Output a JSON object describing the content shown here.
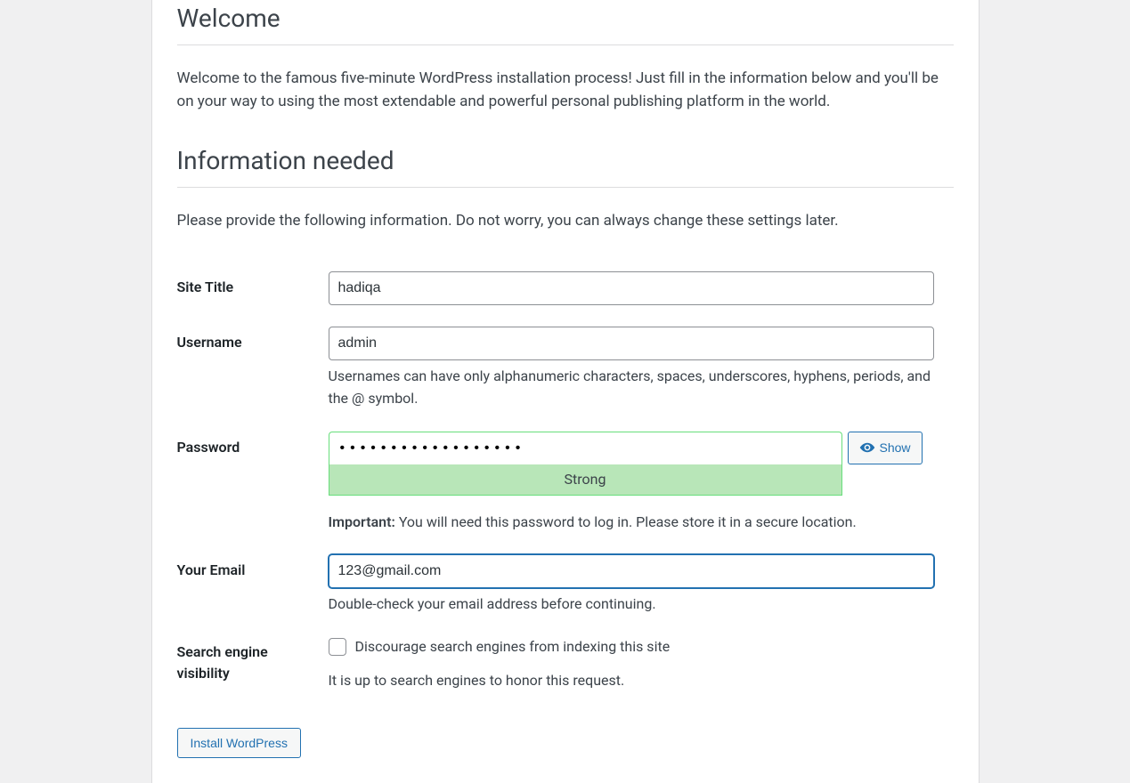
{
  "headings": {
    "welcome": "Welcome",
    "info_needed": "Information needed"
  },
  "intro": {
    "welcome_text": "Welcome to the famous five-minute WordPress installation process! Just fill in the information below and you'll be on your way to using the most extendable and powerful personal publishing platform in the world.",
    "info_text": "Please provide the following information. Do not worry, you can always change these settings later."
  },
  "form": {
    "site_title": {
      "label": "Site Title",
      "value": "hadiqa"
    },
    "username": {
      "label": "Username",
      "value": "admin",
      "hint": "Usernames can have only alphanumeric characters, spaces, underscores, hyphens, periods, and the @ symbol."
    },
    "password": {
      "label": "Password",
      "value": "••••••••••••••••••",
      "strength": "Strong",
      "show_label": "Show",
      "important_label": "Important:",
      "important_text": " You will need this password to log in. Please store it in a secure location."
    },
    "email": {
      "label": "Your Email",
      "value": "123@gmail.com",
      "hint": "Double-check your email address before continuing."
    },
    "search_engine": {
      "label": "Search engine visibility",
      "checkbox_label": "Discourage search engines from indexing this site",
      "hint": "It is up to search engines to honor this request."
    },
    "submit": "Install WordPress"
  }
}
